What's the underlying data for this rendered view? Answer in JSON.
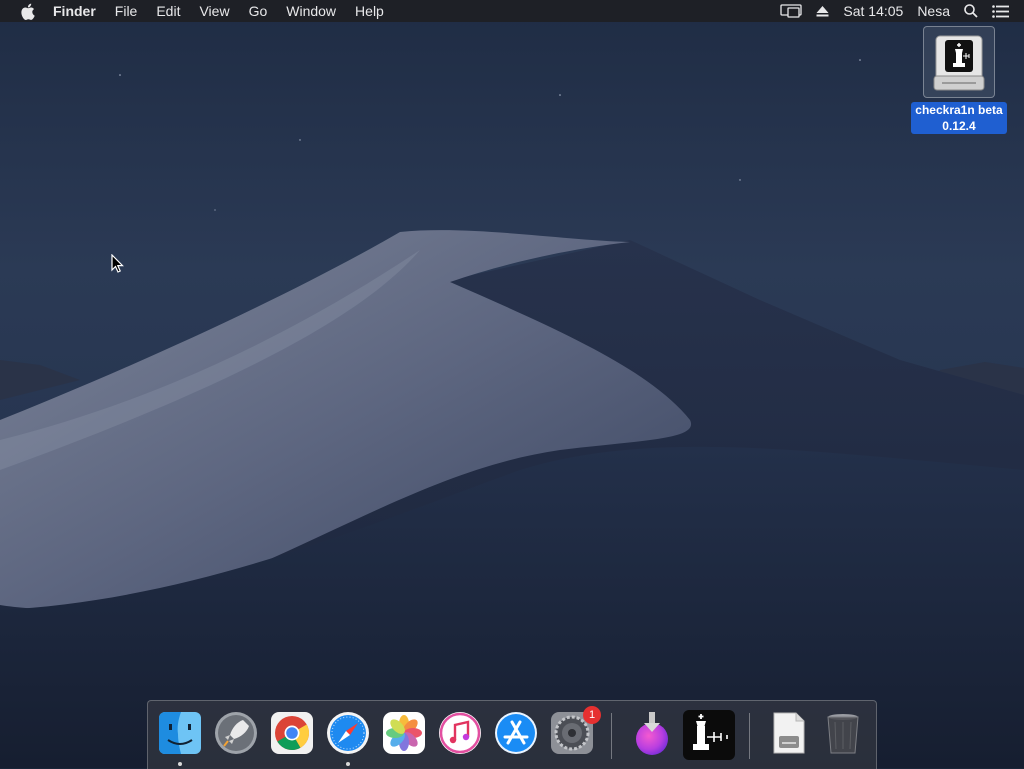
{
  "menubar": {
    "app_name": "Finder",
    "menus": [
      "File",
      "Edit",
      "View",
      "Go",
      "Window",
      "Help"
    ],
    "clock": "Sat 14:05",
    "user": "Nesa",
    "status_icons": [
      "display-mirroring-icon",
      "eject-icon",
      "spotlight-icon",
      "notification-center-icon"
    ]
  },
  "desktop": {
    "icon": {
      "label_line1": "checkra1n beta",
      "label_line2": "0.12.4",
      "icon": "checkra1n-disk-image-icon"
    }
  },
  "dock": {
    "apps": [
      {
        "name": "Finder",
        "icon": "finder-icon",
        "running": true
      },
      {
        "name": "Launchpad",
        "icon": "launchpad-icon",
        "running": false
      },
      {
        "name": "Google Chrome",
        "icon": "chrome-icon",
        "running": false
      },
      {
        "name": "Safari",
        "icon": "safari-icon",
        "running": true
      },
      {
        "name": "Photos",
        "icon": "photos-icon",
        "running": false
      },
      {
        "name": "iTunes",
        "icon": "itunes-icon",
        "running": false
      },
      {
        "name": "App Store",
        "icon": "app-store-icon",
        "running": false
      },
      {
        "name": "System Preferences",
        "icon": "system-preferences-icon",
        "running": false,
        "badge": "1"
      },
      {
        "name": "Downloads",
        "icon": "downloads-icon",
        "running": false
      },
      {
        "name": "checkra1n",
        "icon": "checkra1n-icon",
        "running": false
      },
      {
        "name": "Document",
        "icon": "document-icon",
        "running": false
      },
      {
        "name": "Trash",
        "icon": "trash-icon",
        "running": false
      }
    ]
  },
  "colors": {
    "selection_blue": "#1f5fd1",
    "badge_red": "#e63030",
    "menubar_bg": "#1e1f24"
  }
}
